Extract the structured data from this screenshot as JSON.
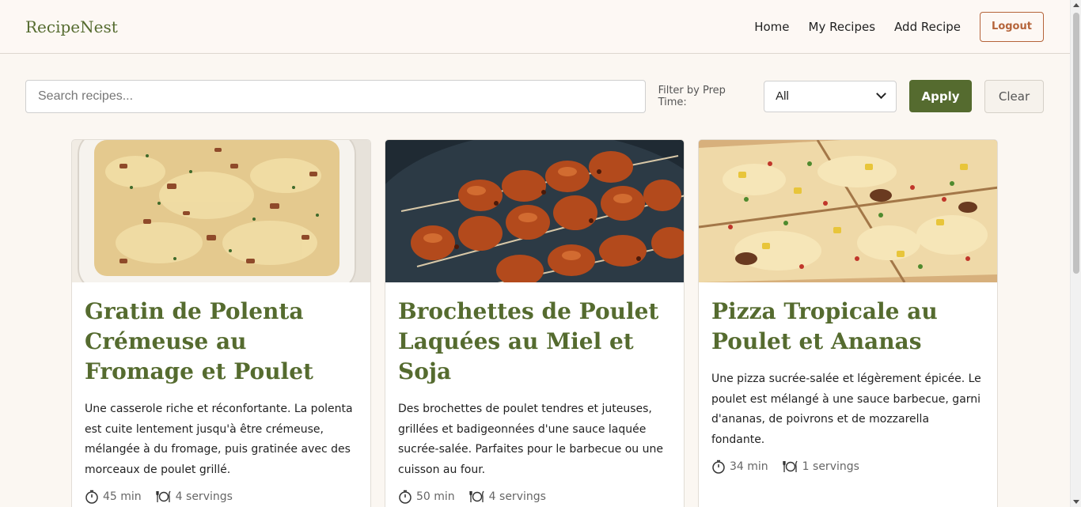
{
  "brand": "RecipeNest",
  "nav": {
    "home": "Home",
    "my_recipes": "My Recipes",
    "add_recipe": "Add Recipe",
    "logout": "Logout"
  },
  "filters": {
    "search_placeholder": "Search recipes...",
    "search_value": "",
    "prep_label": "Filter by Prep Time:",
    "prep_selected": "All",
    "apply": "Apply",
    "clear": "Clear"
  },
  "recipes": [
    {
      "title": "Gratin de Polenta Crémeuse au Fromage et Poulet",
      "description": "Une casserole riche et réconfortante. La polenta est cuite lentement jusqu'à être crémeuse, mélangée à du fromage, puis gratinée avec des morceaux de poulet grillé.",
      "prep_time": "45 min",
      "servings": "4 servings"
    },
    {
      "title": "Brochettes de Poulet Laquées au Miel et Soja",
      "description": "Des brochettes de poulet tendres et juteuses, grillées et badigeonnées d'une sauce laquée sucrée-salée. Parfaites pour le barbecue ou une cuisson au four.",
      "prep_time": "50 min",
      "servings": "4 servings"
    },
    {
      "title": "Pizza Tropicale au Poulet et Ananas",
      "description": "Une pizza sucrée-salée et légèrement épicée. Le poulet est mélangé à une sauce barbecue, garni d'ananas, de poivrons et de mozzarella fondante.",
      "prep_time": "34 min",
      "servings": "1 servings"
    }
  ],
  "colors": {
    "accent": "#556b2f",
    "logout": "#b5643a",
    "background": "#fbf7f2"
  },
  "icons": {
    "time": "timer-icon",
    "servings": "plate-utensils-icon"
  }
}
